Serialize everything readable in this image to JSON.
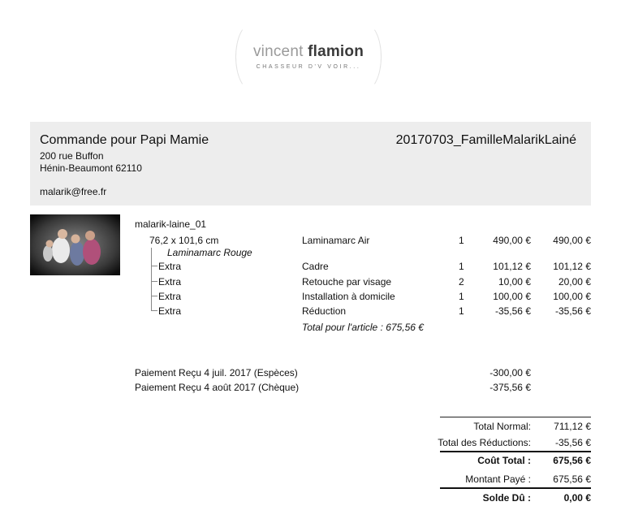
{
  "logo": {
    "word1": "vincent",
    "word2": "flamion",
    "tagline": "CHASSEUR D'V VOIR..."
  },
  "header": {
    "title": "Commande pour Papi Mamie",
    "reference": "20170703_FamilleMalarikLainé",
    "address_line1": "200 rue Buffon",
    "address_line2": "Hénin-Beaumont  62110",
    "email": "malarik@free.fr"
  },
  "item": {
    "image_label": "malarik-laine_01",
    "size": "76,2 x 101,6 cm",
    "finish": "Laminamarc Rouge",
    "main": {
      "product": "Laminamarc Air",
      "qty": "1",
      "unit": "490,00 €",
      "total": "490,00 €"
    },
    "extras": [
      {
        "label": "Extra",
        "product": "Cadre",
        "qty": "1",
        "unit": "101,12 €",
        "total": "101,12 €"
      },
      {
        "label": "Extra",
        "product": "Retouche par visage",
        "qty": "2",
        "unit": "10,00 €",
        "total": "20,00 €"
      },
      {
        "label": "Extra",
        "product": "Installation à domicile",
        "qty": "1",
        "unit": "100,00 €",
        "total": "100,00 €"
      },
      {
        "label": "Extra",
        "product": "Réduction",
        "qty": "1",
        "unit": "-35,56 €",
        "total": "-35,56 €"
      }
    ],
    "article_total": "Total pour l'article : 675,56 €"
  },
  "payments": [
    {
      "label": "Paiement Reçu 4 juil. 2017 (Espèces)",
      "amount": "-300,00 €"
    },
    {
      "label": "Paiement Reçu 4 août 2017 (Chèque)",
      "amount": "-375,56 €"
    }
  ],
  "summary": {
    "normal_label": "Total Normal:",
    "normal_value": "711,12 €",
    "reductions_label": "Total des Réductions:",
    "reductions_value": "-35,56 €",
    "cost_label": "Coût Total :",
    "cost_value": "675,56 €",
    "paid_label": "Montant Payé :",
    "paid_value": "675,56 €",
    "due_label": "Solde Dû :",
    "due_value": "0,00 €"
  }
}
